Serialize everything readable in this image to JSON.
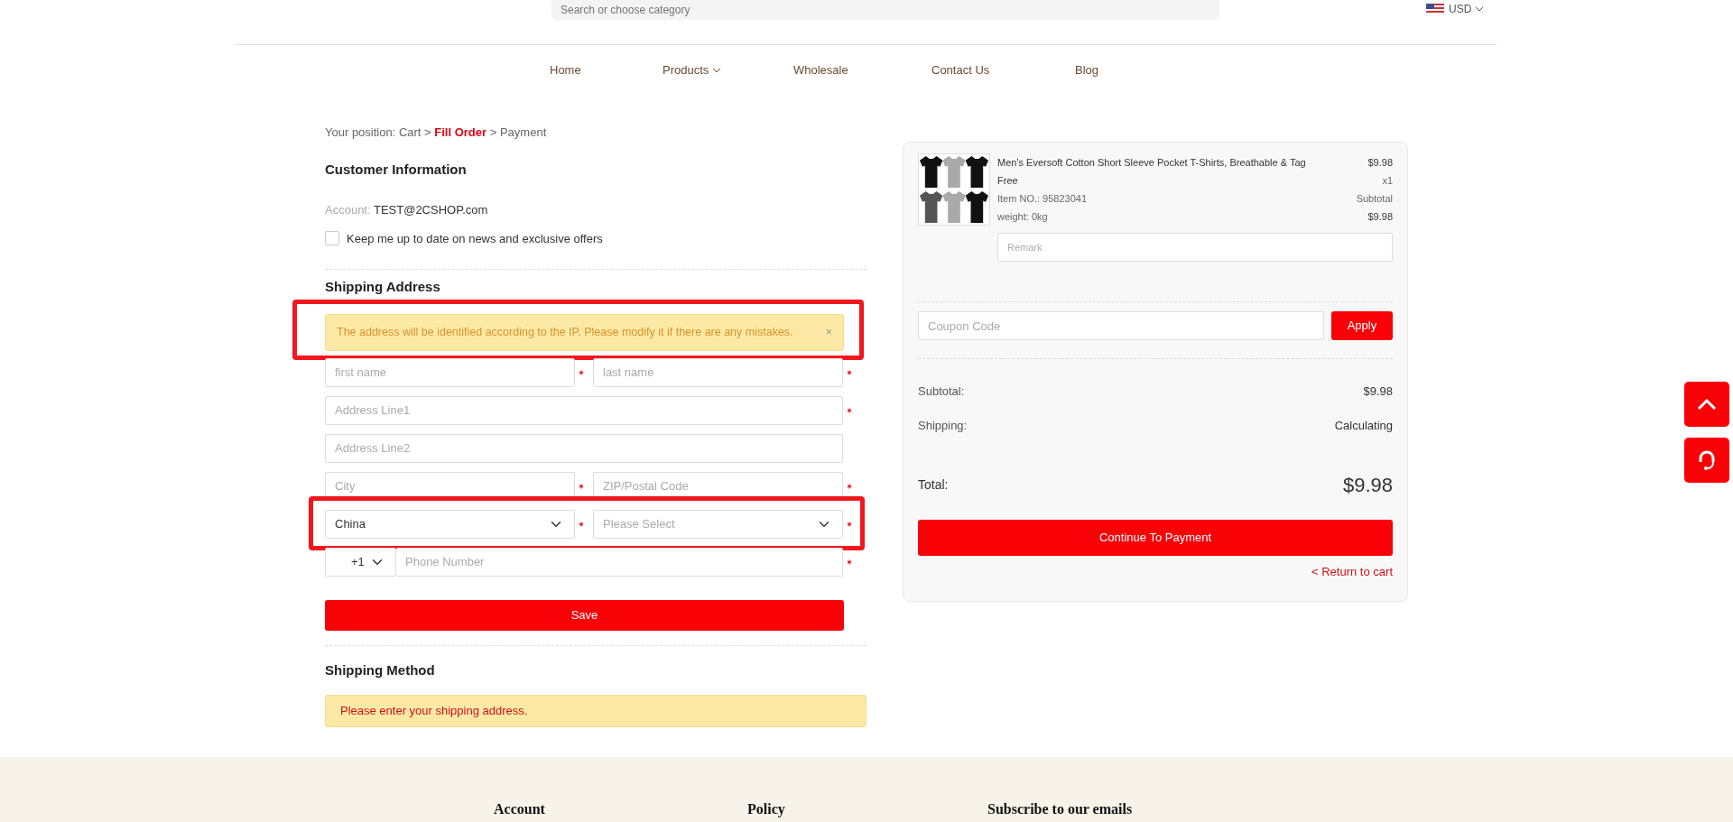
{
  "header": {
    "search": {
      "placeholder": "Search or choose category"
    },
    "currency": "USD"
  },
  "nav": [
    {
      "label": "Home",
      "dropdown": false
    },
    {
      "label": "Products",
      "dropdown": true
    },
    {
      "label": "Wholesale",
      "dropdown": false
    },
    {
      "label": "Contact Us",
      "dropdown": false
    },
    {
      "label": "Blog",
      "dropdown": false
    }
  ],
  "breadcrumb": {
    "prefix": "Your position:",
    "separator": ">",
    "items": [
      {
        "label": "Cart",
        "selected": false
      },
      {
        "label": "Fill Order",
        "selected": true
      },
      {
        "label": "Payment",
        "selected": false
      }
    ]
  },
  "customer": {
    "title": "Customer Information",
    "account_label": "Account:",
    "account": "TEST@2CSHOP.com",
    "newsletter": {
      "label": "Keep me up to date on news and exclusive offers",
      "checked": false
    }
  },
  "shipping_address": {
    "title": "Shipping Address",
    "notice": {
      "text": "The address will be identified according to the IP. Please modify it if there are any mistakes.",
      "close": "×",
      "highlighted": true
    },
    "rows": [
      {
        "highlighted": false,
        "fields": [
          {
            "kind": "input",
            "placeholder": "first name",
            "required": true
          },
          {
            "kind": "input",
            "placeholder": "last name",
            "required": true
          }
        ]
      },
      {
        "highlighted": false,
        "fields": [
          {
            "kind": "input",
            "placeholder": "Address Line1",
            "required": true
          }
        ]
      },
      {
        "highlighted": false,
        "fields": [
          {
            "kind": "input",
            "placeholder": "Address Line2",
            "required": false
          }
        ]
      },
      {
        "highlighted": false,
        "fields": [
          {
            "kind": "input",
            "placeholder": "City",
            "required": true
          },
          {
            "kind": "input",
            "placeholder": "ZIP/Postal Code",
            "required": true
          }
        ]
      },
      {
        "highlighted": true,
        "fields": [
          {
            "kind": "select",
            "value": "China",
            "required": true
          },
          {
            "kind": "select",
            "placeholder": "Please Select",
            "required": true
          }
        ]
      },
      {
        "highlighted": false,
        "fields": [
          {
            "kind": "phone",
            "code": "+1",
            "placeholder": "Phone Number",
            "required": true
          }
        ]
      }
    ],
    "save": "Save"
  },
  "shipping_method": {
    "title": "Shipping Method",
    "notice": "Please enter your shipping address."
  },
  "order": {
    "items": [
      {
        "title": "Men's Eversoft Cotton Short Sleeve Pocket T-Shirts, Breathable & Tag",
        "variant": "Free",
        "item_no": "Item NO.: 95823041",
        "weight": "weight: 0kg",
        "price": "$9.98",
        "quantity": "x1",
        "subtotal_label": "Subtotal",
        "subtotal": "$9.98",
        "remark_placeholder": "Remark"
      }
    ],
    "coupon_placeholder": "Coupon Code",
    "apply": "Apply",
    "summary": [
      {
        "label": "Subtotal:",
        "value": "$9.98"
      },
      {
        "label": "Shipping:",
        "value": "Calculating"
      }
    ],
    "total_label": "Total:",
    "total": "$9.98",
    "continue": "Continue To Payment",
    "return": "< Return to cart"
  },
  "footer": {
    "headings": [
      "Account",
      "Policy",
      "Subscribe to our emails"
    ]
  }
}
